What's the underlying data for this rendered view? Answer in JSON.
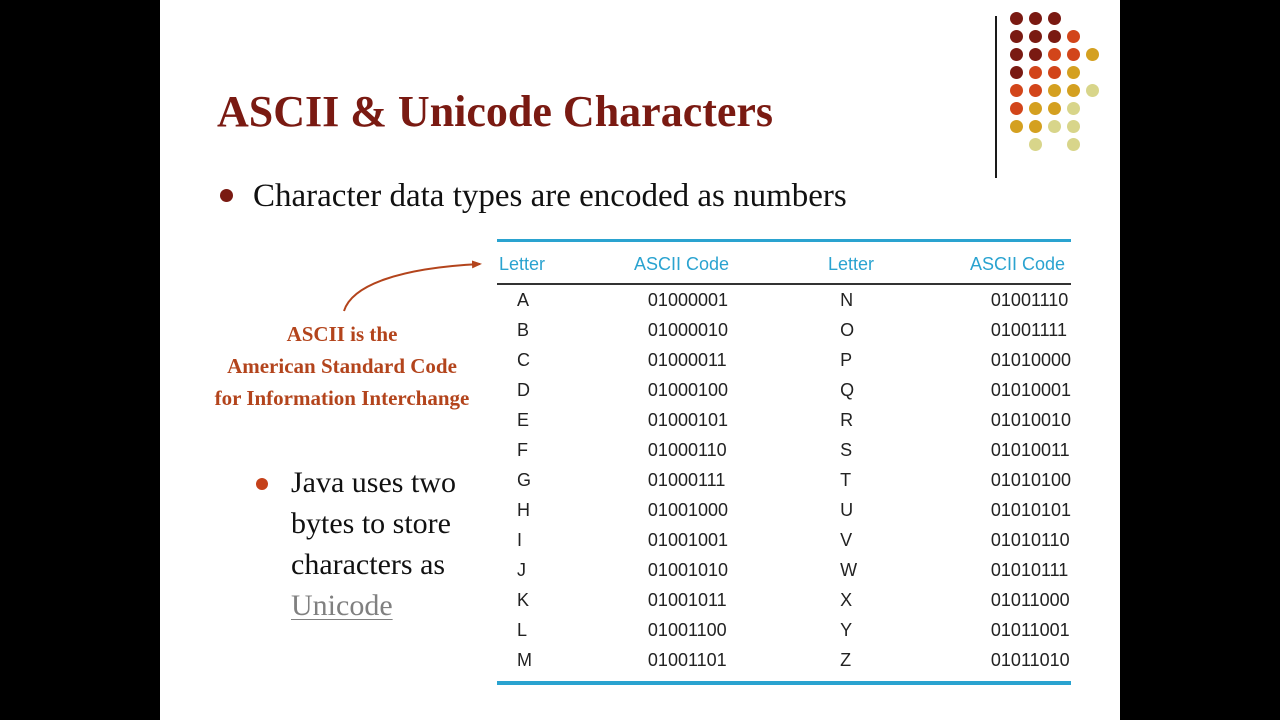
{
  "slide": {
    "title": "ASCII & Unicode Characters",
    "bullet_main": "Character data types are encoded as numbers",
    "callout": {
      "line1": "ASCII is the",
      "line2": "American Standard Code",
      "line3": "for Information Interchange"
    },
    "bullet_secondary": {
      "text_before_link": "Java uses two bytes to store characters as ",
      "link_text": "Unicode"
    },
    "colors": {
      "title": "#7a1a12",
      "callout": "#b3441c",
      "table_accent": "#2aa3d0",
      "link": "#808080"
    },
    "decor_dots": [
      [
        "#7a1a12",
        "#7a1a12",
        "#7a1a12",
        null,
        null
      ],
      [
        "#7a1a12",
        "#7a1a12",
        "#7a1a12",
        "#d2451a",
        null
      ],
      [
        "#7a1a12",
        "#7a1a12",
        "#d2451a",
        "#d2451a",
        "#d4a020"
      ],
      [
        "#7a1a12",
        "#d2451a",
        "#d2451a",
        "#d4a020",
        null
      ],
      [
        "#d2451a",
        "#d2451a",
        "#d4a020",
        "#d4a020",
        "#d8d58a"
      ],
      [
        "#d2451a",
        "#d4a020",
        "#d4a020",
        "#d8d58a",
        null
      ],
      [
        "#d4a020",
        "#d4a020",
        "#d8d58a",
        "#d8d58a",
        null
      ],
      [
        null,
        "#d8d58a",
        null,
        "#d8d58a",
        null
      ]
    ]
  },
  "table": {
    "headers": [
      "Letter",
      "ASCII Code",
      "Letter",
      "ASCII Code"
    ],
    "rows": [
      [
        "A",
        "01000001",
        "N",
        "01001110"
      ],
      [
        "B",
        "01000010",
        "O",
        "01001111"
      ],
      [
        "C",
        "01000011",
        "P",
        "01010000"
      ],
      [
        "D",
        "01000100",
        "Q",
        "01010001"
      ],
      [
        "E",
        "01000101",
        "R",
        "01010010"
      ],
      [
        "F",
        "01000110",
        "S",
        "01010011"
      ],
      [
        "G",
        "01000111",
        "T",
        "01010100"
      ],
      [
        "H",
        "01001000",
        "U",
        "01010101"
      ],
      [
        "I",
        "01001001",
        "V",
        "01010110"
      ],
      [
        "J",
        "01001010",
        "W",
        "01010111"
      ],
      [
        "K",
        "01001011",
        "X",
        "01011000"
      ],
      [
        "L",
        "01001100",
        "Y",
        "01011001"
      ],
      [
        "M",
        "01001101",
        "Z",
        "01011010"
      ]
    ]
  }
}
